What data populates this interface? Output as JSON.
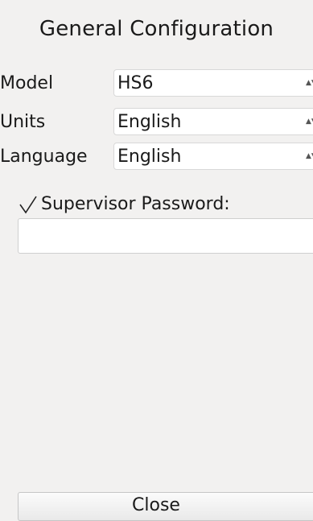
{
  "window": {
    "title": "General Configuration"
  },
  "form": {
    "model": {
      "label": "Model",
      "value": "HS6"
    },
    "units": {
      "label": "Units",
      "value": "English"
    },
    "language": {
      "label": "Language",
      "value": "English"
    },
    "dropdown_arrow": "▲▼",
    "supervisor_password": {
      "label": "Supervisor Password:",
      "checked": true,
      "value": ""
    }
  },
  "footer": {
    "close_label": "Close"
  },
  "icons": {
    "checkbox": "checkmark-icon",
    "dropdown": "dropdown-arrow-icon"
  }
}
